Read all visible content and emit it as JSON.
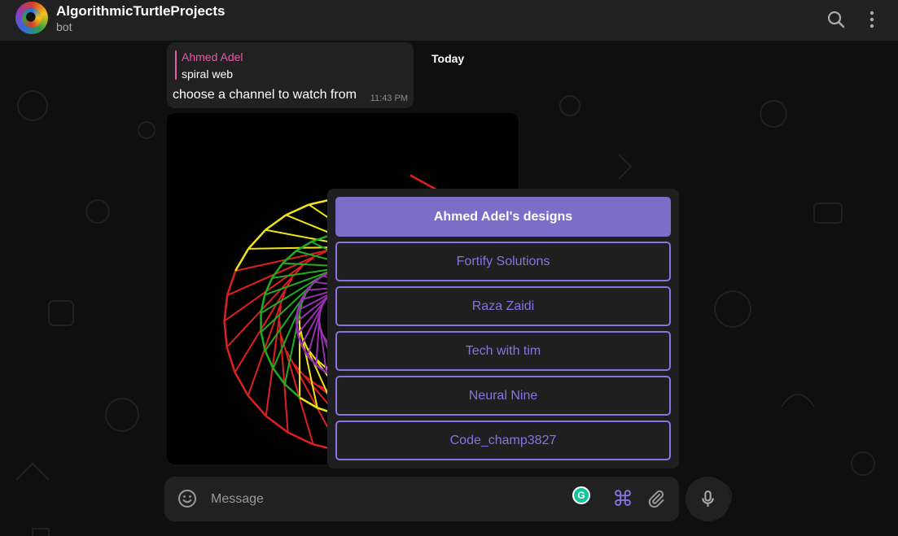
{
  "header": {
    "title": "AlgorithmicTurtleProjects",
    "subtitle": "bot",
    "search_icon": "search-icon",
    "menu_icon": "more-vertical-icon"
  },
  "message": {
    "reply_author": "Ahmed Adel",
    "reply_text": "spiral web",
    "text": "choose a channel to watch from",
    "time": "11:43 PM"
  },
  "date_chip": "Today",
  "keyboard": {
    "buttons": [
      {
        "label": "Ahmed Adel's designs",
        "active": true
      },
      {
        "label": "Fortify Solutions",
        "active": false
      },
      {
        "label": "Raza Zaidi",
        "active": false
      },
      {
        "label": "Tech with tim",
        "active": false
      },
      {
        "label": "Neural Nine",
        "active": false
      },
      {
        "label": "Code_champ3827",
        "active": false
      }
    ]
  },
  "composer": {
    "placeholder": "Message",
    "emoji_icon": "emoji-icon",
    "attach_icon": "paperclip-icon",
    "command_icon": "command-icon",
    "mic_icon": "microphone-icon"
  },
  "colors": {
    "accent": "#8774e1",
    "active_button": "#7b6dc8",
    "reply_author": "#e85aa1",
    "header_bg": "#212121",
    "chat_bg": "#0f0f0f"
  }
}
